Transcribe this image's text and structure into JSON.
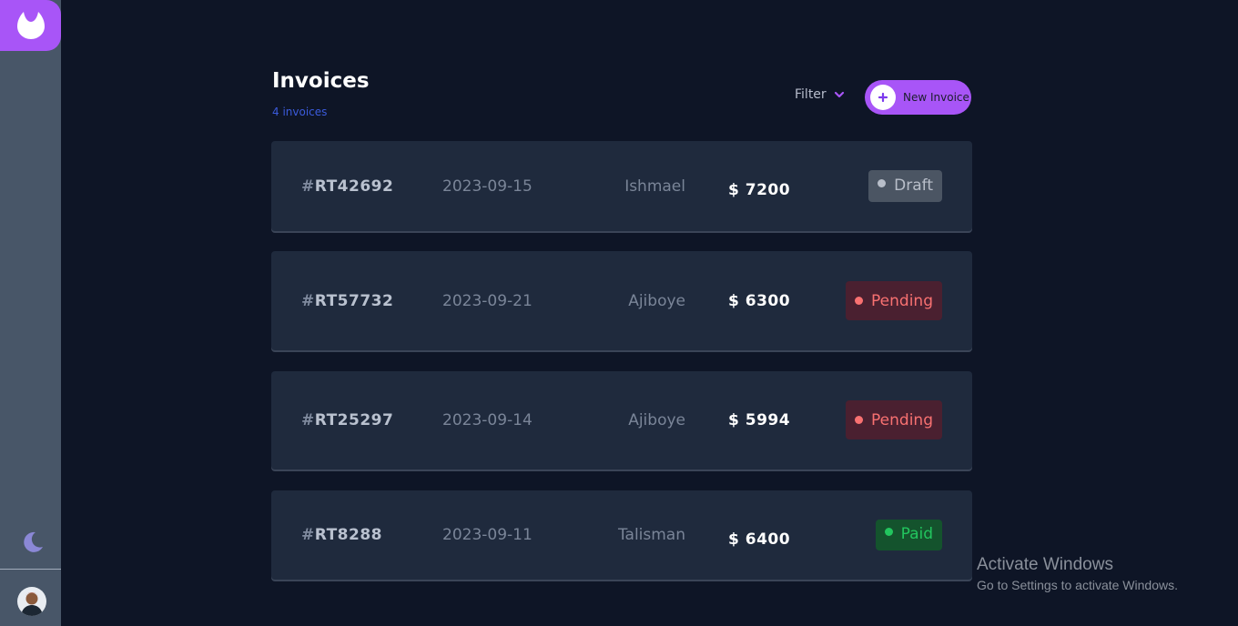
{
  "page": {
    "title": "Invoices",
    "count_label": "4 invoices"
  },
  "toolbar": {
    "filter_label": "Filter",
    "new_invoice_label": "New Invoice"
  },
  "invoices": [
    {
      "id_prefix": "#",
      "id": "RT42692",
      "date": "2023-09-15",
      "client": "Ishmael",
      "amount": "$ 7200",
      "status": "Draft"
    },
    {
      "id_prefix": "#",
      "id": "RT57732",
      "date": "2023-09-21",
      "client": "Ajiboye",
      "amount": "$ 6300",
      "status": "Pending"
    },
    {
      "id_prefix": "#",
      "id": "RT25297",
      "date": "2023-09-14",
      "client": "Ajiboye",
      "amount": "$ 5994",
      "status": "Pending"
    },
    {
      "id_prefix": "#",
      "id": "RT8288",
      "date": "2023-09-11",
      "client": "Talisman",
      "amount": "$ 6400",
      "status": "Paid"
    }
  ],
  "status_colors": {
    "Draft": {
      "bg": "#4b5563",
      "fg": "#b8bec9",
      "dot": "#b8bec9"
    },
    "Pending": {
      "bg": "#4a2030",
      "fg": "#f87171",
      "dot": "#f87171"
    },
    "Paid": {
      "bg": "#14532d",
      "fg": "#22c55e",
      "dot": "#22c55e"
    }
  },
  "colors": {
    "accent": "#a855f7",
    "background": "#0e1526",
    "card": "#1f2a3d",
    "sidebar": "#485668"
  },
  "icons": {
    "logo": "brand-logo-icon",
    "theme": "moon-icon",
    "filter": "chevron-down-icon",
    "new": "plus-icon"
  },
  "watermark": {
    "title": "Activate Windows",
    "subtitle": "Go to Settings to activate Windows."
  }
}
